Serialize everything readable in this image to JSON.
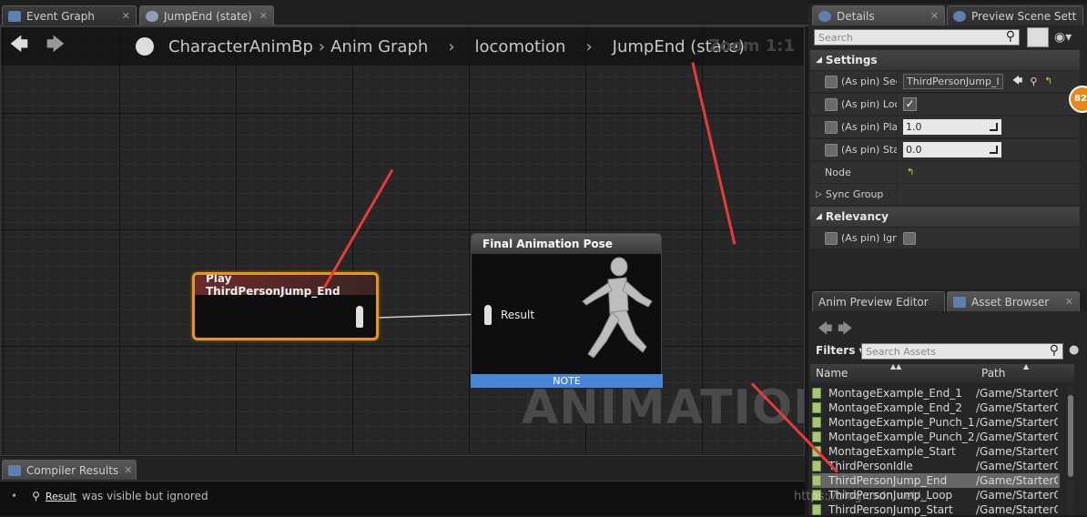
{
  "tabs": {
    "event_graph": "Event Graph",
    "jump_end": "JumpEnd (state)",
    "details": "Details",
    "preview": "Preview Scene Sett"
  },
  "breadcrumb": {
    "items": [
      "CharacterAnimBp",
      "Anim Graph",
      "locomotion",
      "JumpEnd (state)"
    ],
    "zoom": "Zoom 1:1"
  },
  "graph": {
    "play_node_title": "Play ThirdPersonJump_End",
    "final_node_title": "Final Animation Pose",
    "result_label": "Result",
    "note_label": "NOTE",
    "watermark": "ANIMATION"
  },
  "compiler": {
    "tab": "Compiler Results",
    "message_link": "Result",
    "message": "was visible but ignored"
  },
  "details": {
    "search_placeholder": "Search",
    "settings_header": "Settings",
    "rows": [
      {
        "label": "(As pin) Seq",
        "value": "ThirdPersonJump_I"
      },
      {
        "label": "(As pin) Loo",
        "value": ""
      },
      {
        "label": "(As pin) Play",
        "value": "1.0"
      },
      {
        "label": "(As pin) Star",
        "value": "0.0"
      }
    ],
    "node_label": "Node",
    "sync_group": "Sync Group",
    "relevancy_header": "Relevancy",
    "relevancy_row": "(As pin) Ignc",
    "badge": "82"
  },
  "asset_browser": {
    "tab_preview": "Anim Preview Editor",
    "tab_assets": "Asset Browser",
    "filters": "Filters",
    "search_placeholder": "Search Assets",
    "col_name": "Name",
    "col_path": "Path",
    "assets": [
      {
        "name": "MontageExample_End_1",
        "path": "/Game/StarterCo"
      },
      {
        "name": "MontageExample_End_2",
        "path": "/Game/StarterCo"
      },
      {
        "name": "MontageExample_Punch_1",
        "path": "/Game/StarterCo"
      },
      {
        "name": "MontageExample_Punch_2",
        "path": "/Game/StarterCo"
      },
      {
        "name": "MontageExample_Start",
        "path": "/Game/StarterCo"
      },
      {
        "name": "ThirdPersonIdle",
        "path": "/Game/StarterCo"
      },
      {
        "name": "ThirdPersonJump_End",
        "path": "/Game/StarterCo"
      },
      {
        "name": "ThirdPersonJump_Loop",
        "path": "/Game/StarterCo"
      },
      {
        "name": "ThirdPersonJump_Start",
        "path": "/Game/StarterCo"
      }
    ]
  },
  "page_watermark": "https://blog.csdn.net/..."
}
